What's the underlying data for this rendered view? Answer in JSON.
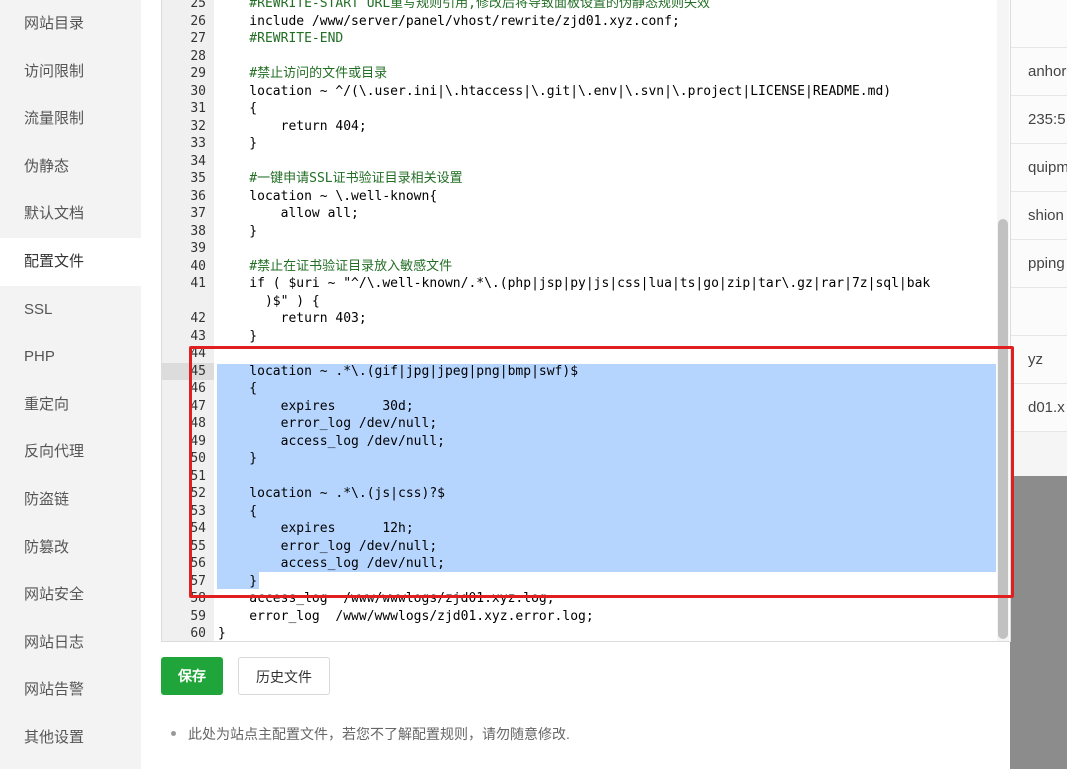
{
  "sidebar": {
    "items": [
      {
        "label": "网站目录"
      },
      {
        "label": "访问限制"
      },
      {
        "label": "流量限制"
      },
      {
        "label": "伪静态"
      },
      {
        "label": "默认文档"
      },
      {
        "label": "配置文件",
        "active": true
      },
      {
        "label": "SSL"
      },
      {
        "label": "PHP"
      },
      {
        "label": "重定向"
      },
      {
        "label": "反向代理"
      },
      {
        "label": "防盗链"
      },
      {
        "label": "防篡改"
      },
      {
        "label": "网站安全"
      },
      {
        "label": "网站日志"
      },
      {
        "label": "网站告警"
      },
      {
        "label": "其他设置"
      }
    ]
  },
  "editor": {
    "lines": [
      {
        "n": "25",
        "text": "    #REWRITE-START URL重写规则引用,修改后将导致面板设置的伪静态规则失效"
      },
      {
        "n": "26",
        "text": "    include /www/server/panel/vhost/rewrite/zjd01.xyz.conf;"
      },
      {
        "n": "27",
        "text": "    #REWRITE-END"
      },
      {
        "n": "28",
        "text": ""
      },
      {
        "n": "29",
        "text": "    #禁止访问的文件或目录"
      },
      {
        "n": "30",
        "text": "    location ~ ^/(\\.user.ini|\\.htaccess|\\.git|\\.env|\\.svn|\\.project|LICENSE|README.md)"
      },
      {
        "n": "31",
        "text": "    {"
      },
      {
        "n": "32",
        "text": "        return 404;"
      },
      {
        "n": "33",
        "text": "    }"
      },
      {
        "n": "34",
        "text": ""
      },
      {
        "n": "35",
        "text": "    #一键申请SSL证书验证目录相关设置"
      },
      {
        "n": "36",
        "text": "    location ~ \\.well-known{"
      },
      {
        "n": "37",
        "text": "        allow all;"
      },
      {
        "n": "38",
        "text": "    }"
      },
      {
        "n": "39",
        "text": ""
      },
      {
        "n": "40",
        "text": "    #禁止在证书验证目录放入敏感文件"
      },
      {
        "n": "41",
        "text": "    if ( $uri ~ \"^/\\.well-known/.*\\.(php|jsp|py|js|css|lua|ts|go|zip|tar\\.gz|rar|7z|sql|bak"
      },
      {
        "n": "",
        "text": "      )$\" ) {"
      },
      {
        "n": "42",
        "text": "        return 403;"
      },
      {
        "n": "43",
        "text": "    }"
      },
      {
        "n": "44",
        "text": ""
      },
      {
        "n": "45",
        "text": "    location ~ .*\\.(gif|jpg|jpeg|png|bmp|swf)$"
      },
      {
        "n": "46",
        "text": "    {"
      },
      {
        "n": "47",
        "text": "        expires      30d;"
      },
      {
        "n": "48",
        "text": "        error_log /dev/null;"
      },
      {
        "n": "49",
        "text": "        access_log /dev/null;"
      },
      {
        "n": "50",
        "text": "    }"
      },
      {
        "n": "51",
        "text": ""
      },
      {
        "n": "52",
        "text": "    location ~ .*\\.(js|css)?$"
      },
      {
        "n": "53",
        "text": "    {"
      },
      {
        "n": "54",
        "text": "        expires      12h;"
      },
      {
        "n": "55",
        "text": "        error_log /dev/null;"
      },
      {
        "n": "56",
        "text": "        access_log /dev/null;"
      },
      {
        "n": "57",
        "text": "    }"
      },
      {
        "n": "58",
        "text": "    access_log  /www/wwwlogs/zjd01.xyz.log;"
      },
      {
        "n": "59",
        "text": "    error_log  /www/wwwlogs/zjd01.xyz.error.log;"
      },
      {
        "n": "60",
        "text": "}"
      }
    ],
    "active_line": "45"
  },
  "actions": {
    "save_label": "保存",
    "history_label": "历史文件"
  },
  "note": "此处为站点主配置文件，若您不了解配置规则，请勿随意修改.",
  "background_page": {
    "rows": [
      "",
      "anhor",
      "235:5",
      "quipm",
      "shion",
      "pping",
      "",
      "yz",
      "d01.x"
    ]
  },
  "colors": {
    "save_green": "#20a53a",
    "selection": "#b5d5ff",
    "highlight_red": "#e02020",
    "sidebar_bg": "#f3f3f3"
  }
}
